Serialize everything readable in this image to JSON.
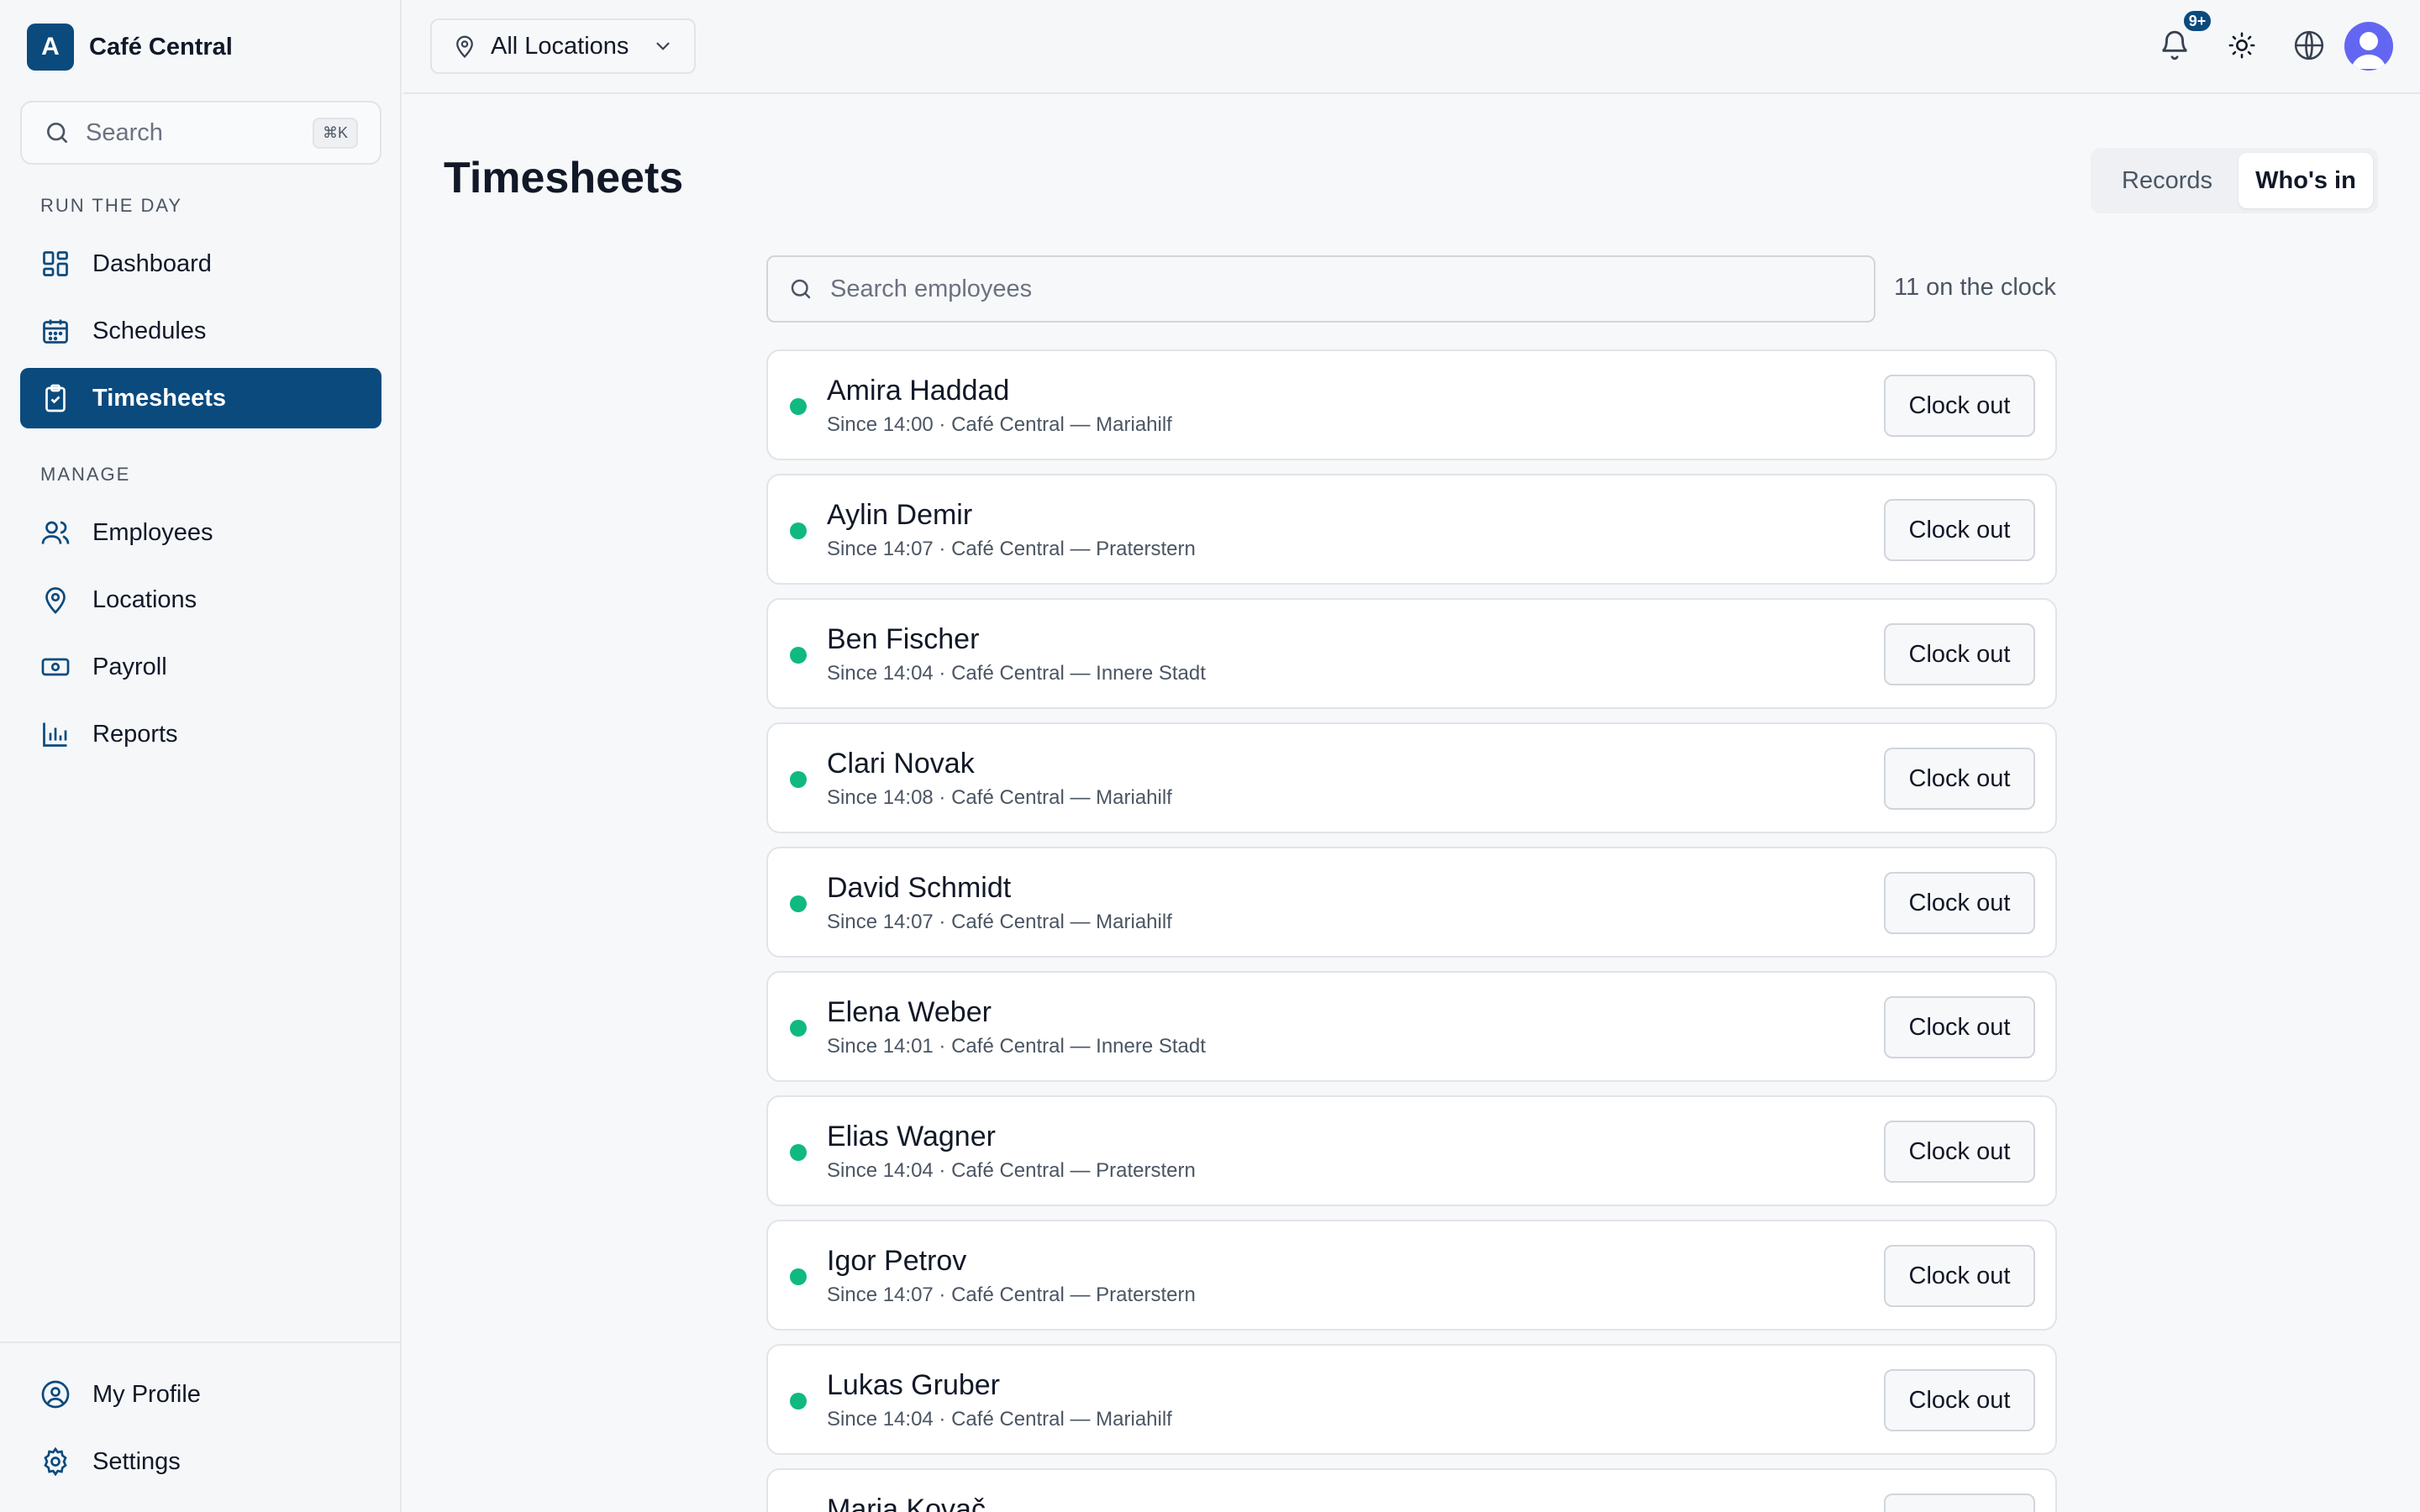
{
  "brand": {
    "logo_letter": "A",
    "name": "Café Central"
  },
  "sidebar": {
    "search_placeholder": "Search",
    "search_shortcut": "⌘K",
    "sections": {
      "run": "RUN THE DAY",
      "manage": "MANAGE"
    },
    "items": [
      {
        "label": "Dashboard",
        "icon": "dashboard-icon"
      },
      {
        "label": "Schedules",
        "icon": "calendar-icon"
      },
      {
        "label": "Timesheets",
        "icon": "clipboard-icon",
        "active": true
      },
      {
        "label": "Employees",
        "icon": "users-icon"
      },
      {
        "label": "Locations",
        "icon": "map-pin-icon"
      },
      {
        "label": "Payroll",
        "icon": "banknote-icon"
      },
      {
        "label": "Reports",
        "icon": "bar-chart-icon"
      }
    ],
    "footer": [
      {
        "label": "My Profile",
        "icon": "user-circle-icon"
      },
      {
        "label": "Settings",
        "icon": "gear-icon"
      }
    ]
  },
  "topbar": {
    "location_select": "All Locations",
    "notifications_badge": "9+"
  },
  "main": {
    "title": "Timesheets",
    "tabs": [
      {
        "label": "Records",
        "active": false
      },
      {
        "label": "Who's in",
        "active": true
      }
    ],
    "search_placeholder": "Search employees",
    "count_label": "11 on the clock",
    "clock_out_label": "Clock out",
    "employees": [
      {
        "name": "Amira Haddad",
        "detail": "Since 14:00 · Café Central — Mariahilf"
      },
      {
        "name": "Aylin Demir",
        "detail": "Since 14:07 · Café Central — Praterstern"
      },
      {
        "name": "Ben Fischer",
        "detail": "Since 14:04 · Café Central — Innere Stadt"
      },
      {
        "name": "Clari Novak",
        "detail": "Since 14:08 · Café Central — Mariahilf"
      },
      {
        "name": "David Schmidt",
        "detail": "Since 14:07 · Café Central — Mariahilf"
      },
      {
        "name": "Elena Weber",
        "detail": "Since 14:01 · Café Central — Innere Stadt"
      },
      {
        "name": "Elias Wagner",
        "detail": "Since 14:04 · Café Central — Praterstern"
      },
      {
        "name": "Igor Petrov",
        "detail": "Since 14:07 · Café Central — Praterstern"
      },
      {
        "name": "Lukas Gruber",
        "detail": "Since 14:04 · Café Central — Mariahilf"
      },
      {
        "name": "Maria Kovač",
        "detail": ""
      }
    ]
  },
  "colors": {
    "brand": "#0b4a7d",
    "status_online": "#10b981",
    "avatar": "#6366f1"
  }
}
